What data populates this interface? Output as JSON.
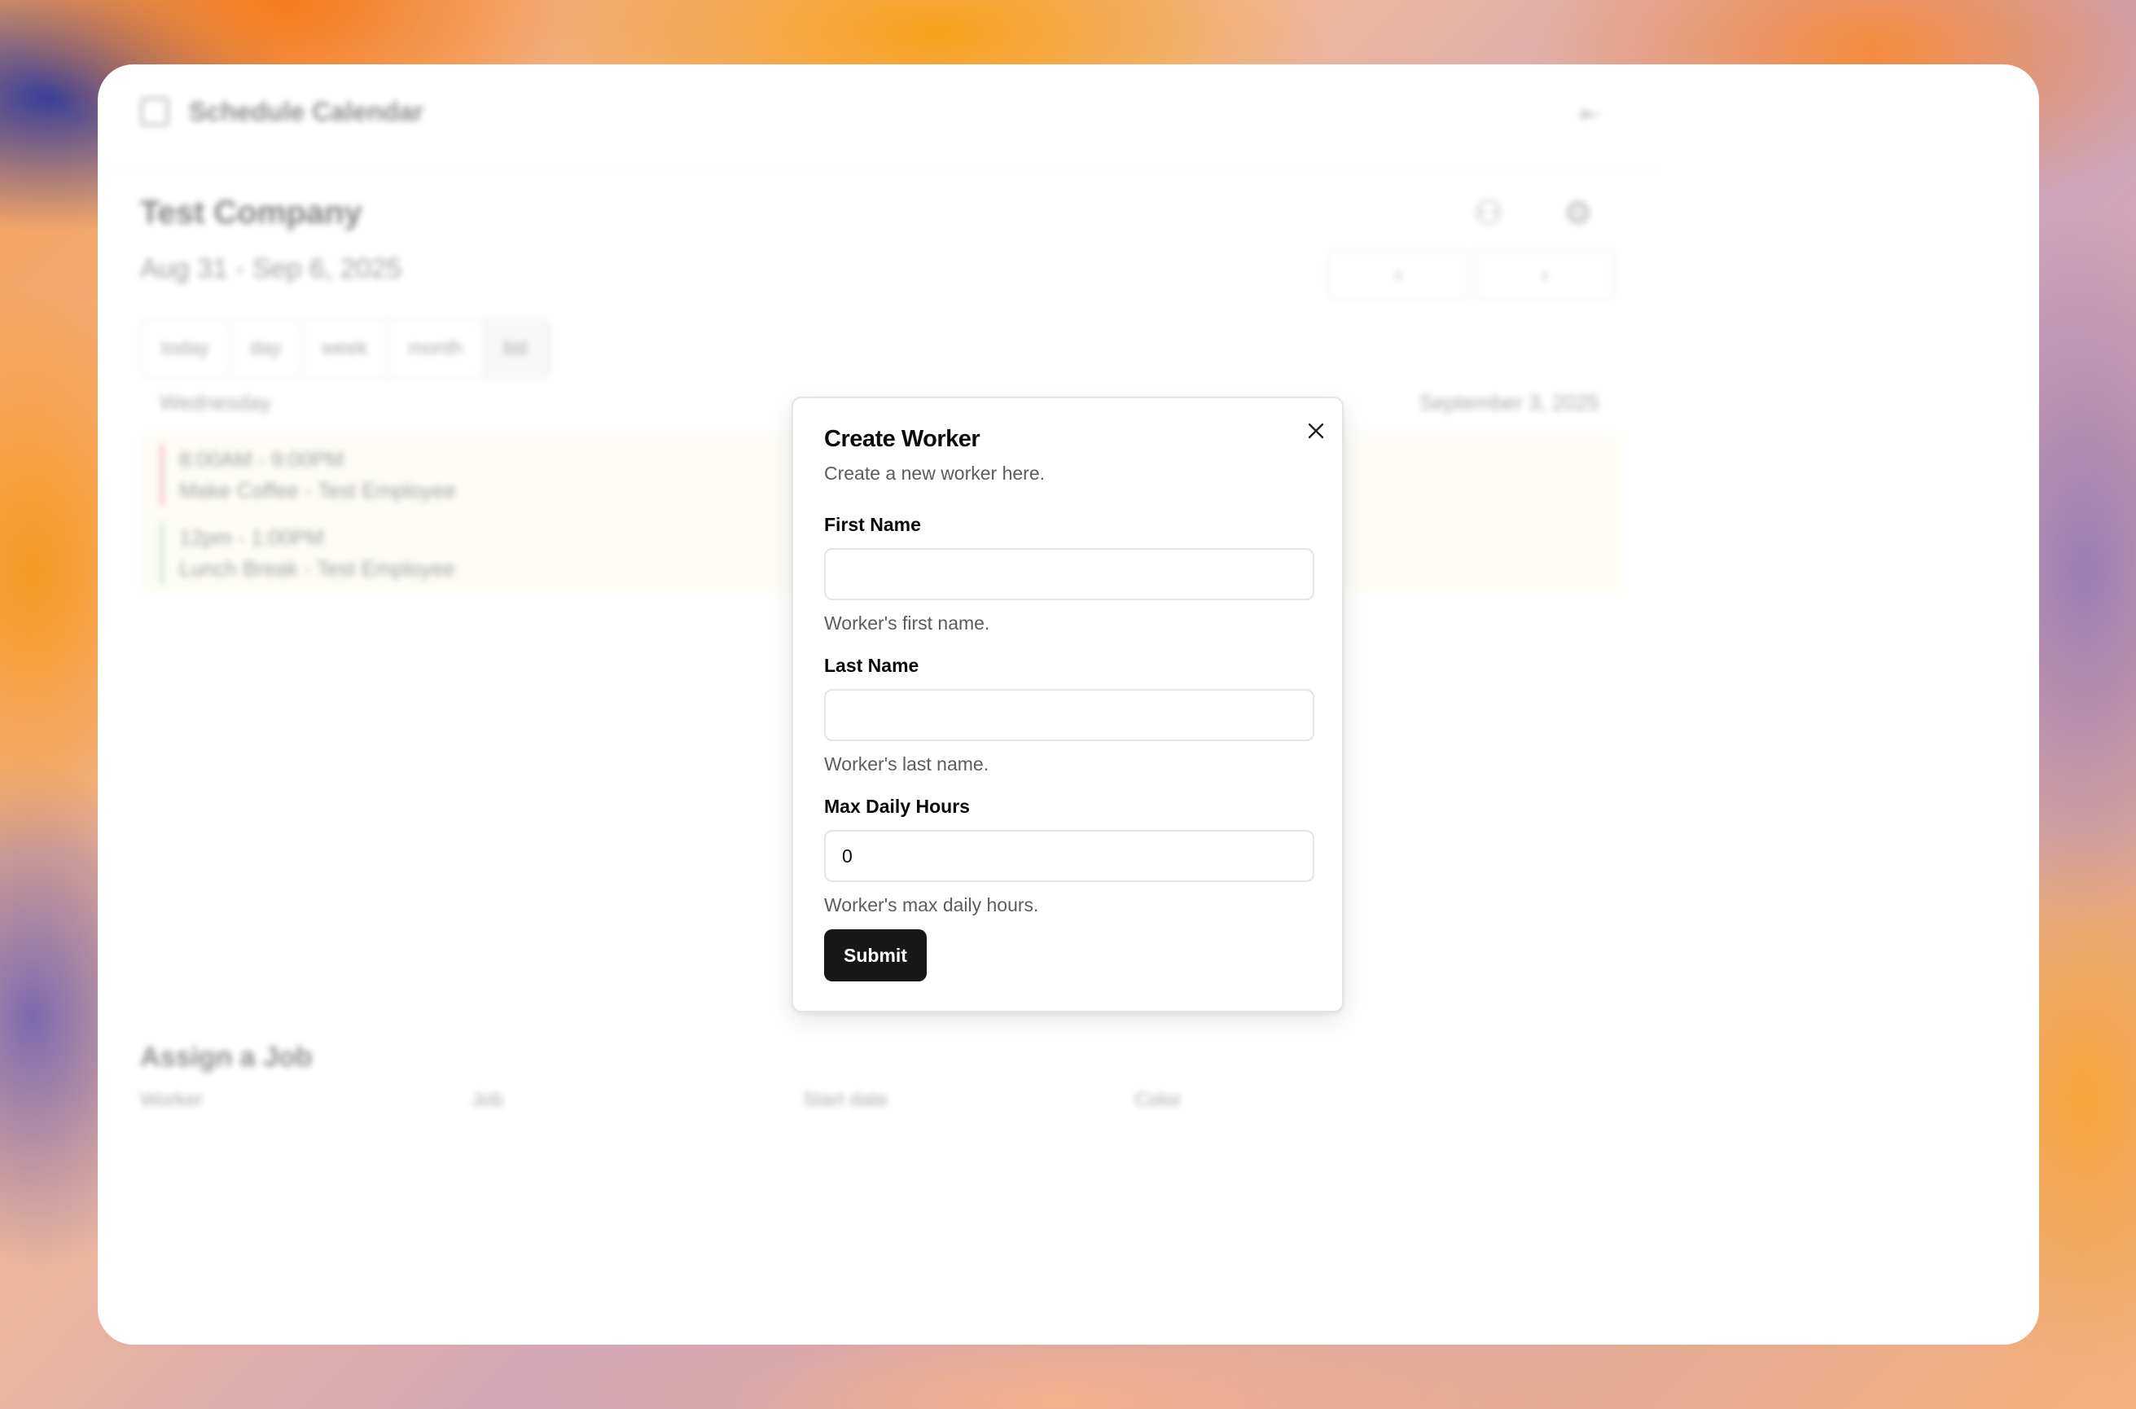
{
  "app": {
    "title": "Schedule Calendar",
    "company": "Test Company",
    "date_range": "Aug 31 - Sep 6, 2025",
    "view_tabs": [
      "today",
      "day",
      "week",
      "month",
      "list"
    ],
    "active_view": "list",
    "day_label": "Wednesday",
    "day_date": "September 3, 2025",
    "events": [
      {
        "time": "8:00AM - 9:00PM",
        "title": "Make Coffee - Test Employee",
        "color": "#f2a6a6"
      },
      {
        "time": "12pm - 1:00PM",
        "title": "Lunch Break - Test Employee",
        "color": "#b8dcb8"
      }
    ],
    "assign": {
      "title": "Assign a Job",
      "columns": [
        "Worker",
        "Job",
        "Start date",
        "Color"
      ]
    }
  },
  "dialog": {
    "title": "Create Worker",
    "description": "Create a new worker here.",
    "fields": [
      {
        "label": "First Name",
        "value": "",
        "help": "Worker's first name."
      },
      {
        "label": "Last Name",
        "value": "",
        "help": "Worker's last name."
      },
      {
        "label": "Max Daily Hours",
        "value": "0",
        "help": "Worker's max daily hours."
      }
    ],
    "submit_label": "Submit",
    "close_icon": "close-icon"
  },
  "colors": {
    "primary_button": "#171717",
    "muted_text": "#5c5c5c",
    "border": "#e4e4e4"
  }
}
